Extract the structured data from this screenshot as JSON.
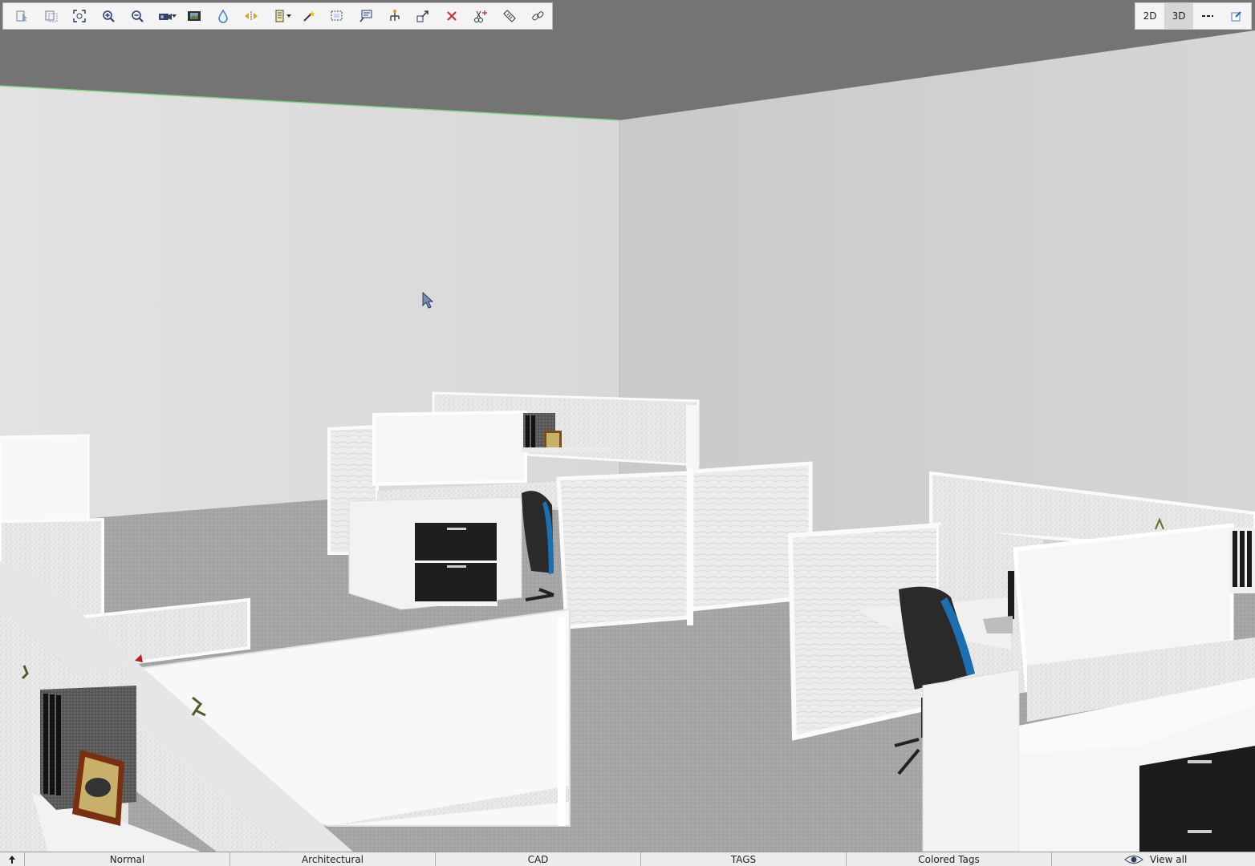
{
  "toolbar": {
    "buttons": [
      {
        "name": "select-objects",
        "icon": "cursor-select-icon"
      },
      {
        "name": "select-all",
        "icon": "select-all-icon"
      },
      {
        "name": "zoom-extents",
        "icon": "zoom-extents-icon"
      },
      {
        "name": "zoom-in",
        "icon": "zoom-in-icon"
      },
      {
        "name": "zoom-out",
        "icon": "zoom-out-icon"
      },
      {
        "name": "camera",
        "icon": "camera-icon",
        "dropdown": true
      },
      {
        "name": "render",
        "icon": "film-icon"
      },
      {
        "name": "material",
        "icon": "paint-drop-icon"
      },
      {
        "name": "mirror",
        "icon": "mirror-arrows-icon"
      },
      {
        "name": "layers",
        "icon": "layers-icon",
        "dropdown": true
      },
      {
        "name": "magic",
        "icon": "magic-wand-icon"
      },
      {
        "name": "box-select",
        "icon": "box-select-icon"
      },
      {
        "name": "comment",
        "icon": "comment-icon"
      },
      {
        "name": "hierarchy",
        "icon": "hierarchy-icon"
      },
      {
        "name": "scale",
        "icon": "scale-icon"
      },
      {
        "name": "delete",
        "icon": "delete-x-icon"
      },
      {
        "name": "cut-edit",
        "icon": "scissors-icon"
      },
      {
        "name": "measure",
        "icon": "ruler-icon"
      },
      {
        "name": "link",
        "icon": "link-icon"
      }
    ]
  },
  "view_toolbar": {
    "btn_2d": "2D",
    "btn_3d": "3D",
    "active": "3D"
  },
  "statusbar": {
    "tabs": [
      "Normal",
      "Architectural",
      "CAD",
      "TAGS",
      "Colored Tags"
    ],
    "view_all": "View all"
  },
  "colors": {
    "ceiling": "#767676",
    "wall_left": "#dadada",
    "wall_right": "#cbcbcb",
    "floor": "#a4a4a4",
    "accent_chair": "#1c6fb0"
  }
}
